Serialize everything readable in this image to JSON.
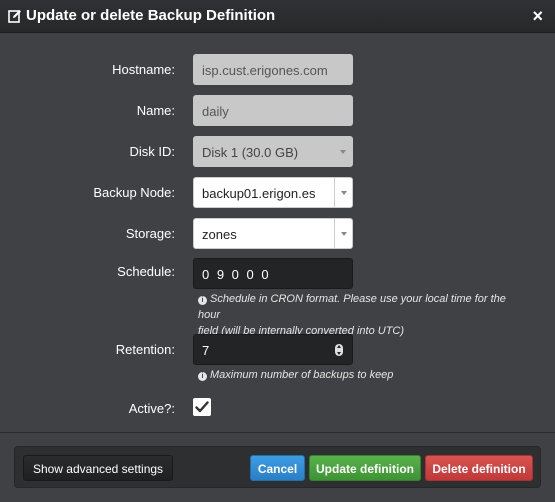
{
  "modal": {
    "title": "Update or delete Backup Definition",
    "edit_icon": "edit-icon",
    "close_label": "×"
  },
  "form": {
    "hostname": {
      "label": "Hostname:",
      "value": "isp.cust.erigones.com"
    },
    "name": {
      "label": "Name:",
      "value": "daily"
    },
    "disk_id": {
      "label": "Disk ID:",
      "value": "Disk 1 (30.0 GB)"
    },
    "backup_node": {
      "label": "Backup Node:",
      "value": "backup01.erigon.es"
    },
    "storage": {
      "label": "Storage:",
      "value": "zones"
    },
    "schedule": {
      "label": "Schedule:",
      "value": "0 9 0 0 0",
      "help_line1": "Schedule in CRON format. Please use your local time for the hour",
      "help_line2": "field (will be internally converted into UTC)"
    },
    "retention": {
      "label": "Retention:",
      "value": "7",
      "help": "Maximum number of backups to keep"
    },
    "active": {
      "label": "Active?:",
      "checked": true
    }
  },
  "footer": {
    "advanced_label": "Show advanced settings",
    "cancel_label": "Cancel",
    "update_label": "Update definition",
    "delete_label": "Delete definition"
  },
  "colors": {
    "cancel": "#2a7fc6",
    "update": "#3e9334",
    "delete": "#c0393a"
  }
}
